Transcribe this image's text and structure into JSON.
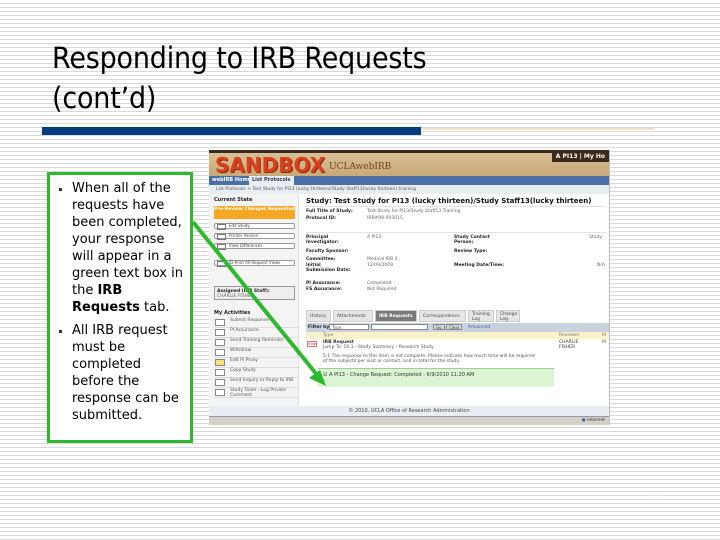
{
  "slide": {
    "title_line1": "Responding to IRB Requests",
    "title_line2": "(cont’d)",
    "slide_number": "31",
    "accent_color": "#003d7a",
    "callout_border_color": "#2eb82e"
  },
  "callout": {
    "bullets": [
      {
        "text_before": "When all of the requests have been completed, your response will appear in a green text box in the ",
        "bold": "IRB Requests",
        "text_after": " tab."
      },
      {
        "text_before": "All IRB request must be completed before the response can be submitted.",
        "bold": "",
        "text_after": ""
      }
    ]
  },
  "screenshot": {
    "logo": "SANDBOX",
    "logo_sub": "UCLAwebIRB",
    "user_bar": "A PI13  |  My Ho",
    "nav": [
      "webIRB Home",
      "List Protocols"
    ],
    "breadcrumb": "List Protocols  >  Test Study for PI13 (lucky thirteen)/Study Staff13(lucky thirteen) training",
    "sidebar": {
      "current_state_label": "Current State",
      "current_state": "Pre-Review Changes Requested",
      "buttons": [
        "Edit Study",
        "Printer Version",
        "View Differences",
        "ID-Print All Request Views"
      ],
      "assigned_label": "Assigned (IRB Staff):",
      "assigned_value": "CHARLIE FISHER",
      "activities_label": "My Activities",
      "activities": [
        "Submit Response",
        "PI Assurance",
        "Send Training Reminder",
        "Withdraw",
        "Edit PI Proxy",
        "Copy Study",
        "Send Inquiry or Reply to IRB",
        "Study Team - Log Private Comment"
      ]
    },
    "study_title": "Study: Test Study for PI13 (lucky thirteen)/Study Staff13(lucky thirteen)",
    "fields": {
      "full_title_label": "Full Title of Study:",
      "full_title_value": "Test Study for PI13/Study Staff13 Training",
      "protocol_id_label": "Protocol ID:",
      "protocol_id_value": "IRB#09-003015",
      "pi_label": "Principal Investigator:",
      "pi_value": "A PI13",
      "study_contact_label": "Study Contact Person:",
      "study_contact_value": "Study",
      "faculty_sponsor_label": "Faculty Sponsor:",
      "review_type_label": "Review Type:",
      "committee_label": "Committee:",
      "committee_value": "Medical IRB 2",
      "initial_submission_label": "Initial Submission Date:",
      "initial_submission_value": "12/09/2009",
      "meeting_label": "Meeting Date/Time:",
      "meeting_value": "N/A",
      "pi_assurance_label": "PI Assurance:",
      "pi_assurance_value": "Completed",
      "fs_assurance_label": "FS Assurance:",
      "fs_assurance_value": "Not Required"
    },
    "tabs": [
      {
        "label": "History",
        "active": false
      },
      {
        "label": "Attachments",
        "active": false
      },
      {
        "label": "IRB Requests",
        "active": true
      },
      {
        "label": "Correspondence",
        "active": false
      },
      {
        "label": "Training Log",
        "active": false
      },
      {
        "label": "Change Log",
        "active": false
      }
    ],
    "filter": {
      "label": "Filter by",
      "select_value": "Type",
      "go": "Go",
      "clear": "Clear",
      "advanced": "Advanced"
    },
    "columns": {
      "type": "Type",
      "reviewer": "Reviewer",
      "m": "M"
    },
    "request": {
      "badge": "Hide",
      "title": "IRB Request",
      "subtitle": "Jump To: 10.1 - Study Summary - Research Study",
      "message_line1": "5.1 The response to this item is not complete. Please indicate how much time will be required",
      "message_line2": "of the subjects per visit or contact, and in total for the study.",
      "reviewer": "CHARLIE FISHER",
      "m": "M"
    },
    "completed_box": {
      "text": "A PI13 - Change Request: Completed - 6/9/2010 11:20 AM",
      "close": "X"
    },
    "footer": "© 2010, UCLA Office of Research Administration",
    "status_zone": "Internet"
  }
}
